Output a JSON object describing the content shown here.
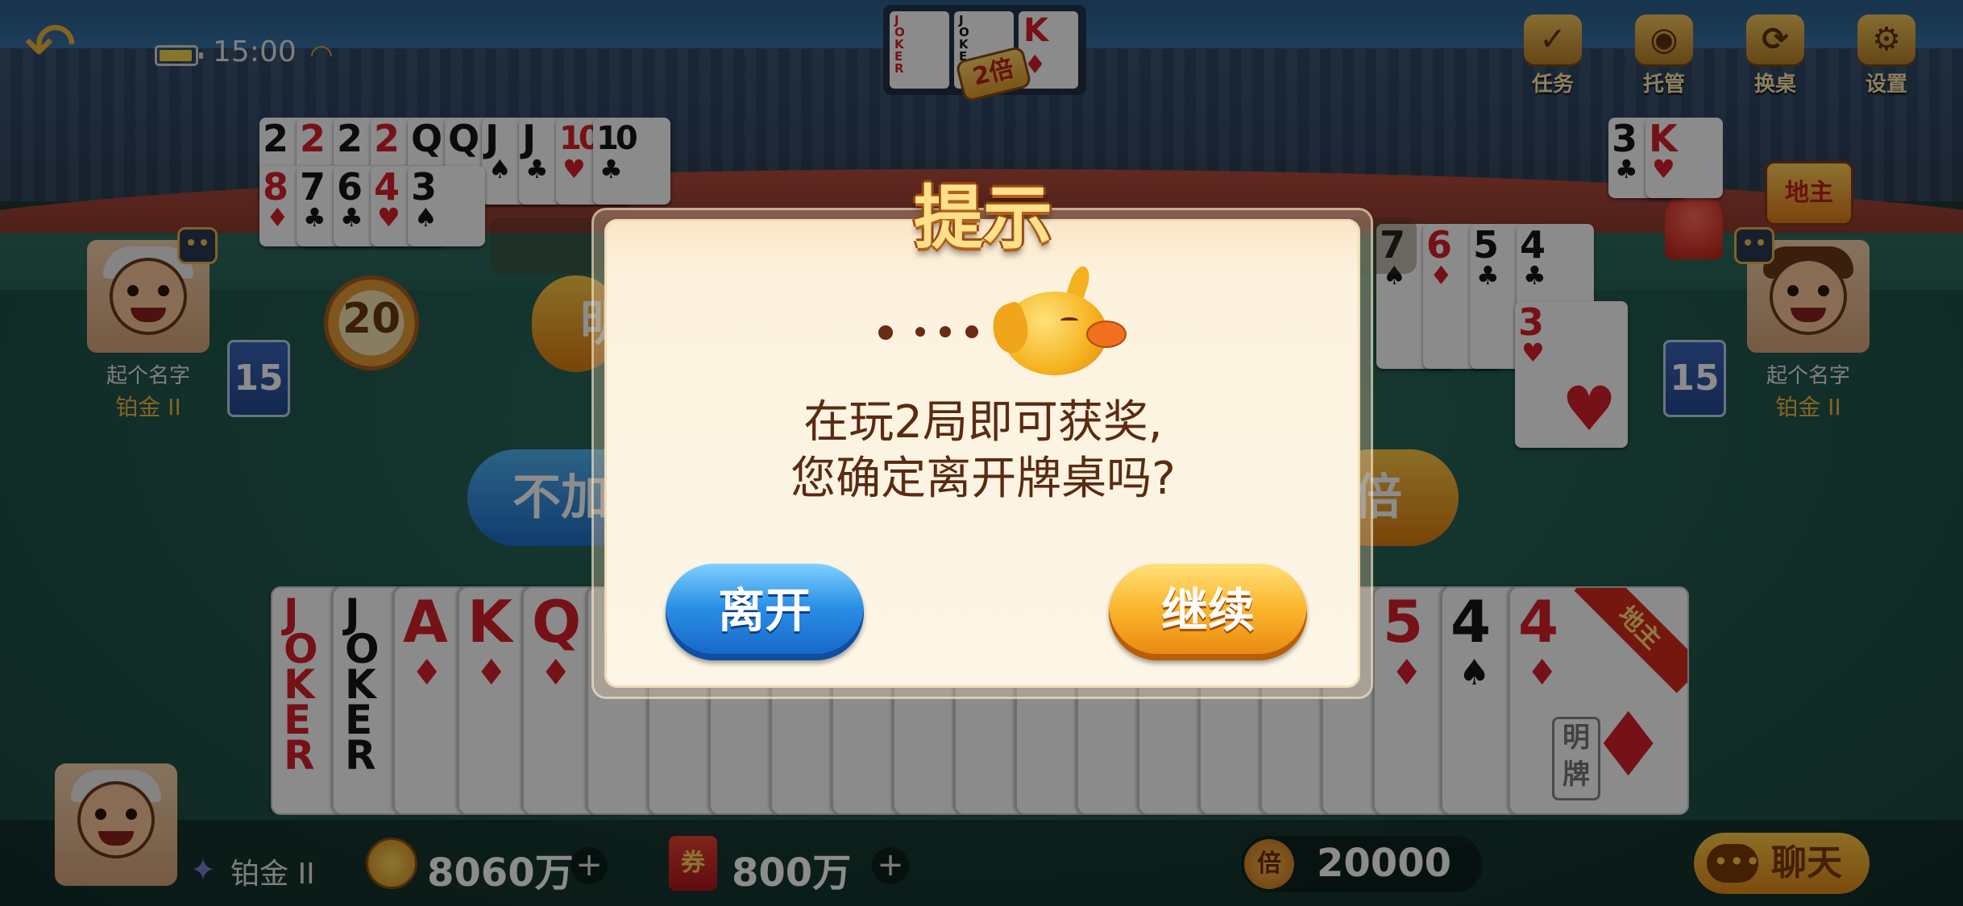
{
  "status": {
    "time": "15:00"
  },
  "toolbar": [
    {
      "label": "任务",
      "icon": "task-icon"
    },
    {
      "label": "托管",
      "icon": "robot-icon"
    },
    {
      "label": "换桌",
      "icon": "refresh-icon"
    },
    {
      "label": "设置",
      "icon": "gear-icon"
    }
  ],
  "base_cards": {
    "cards": [
      {
        "rank": "JOKER",
        "color": "red"
      },
      {
        "rank": "JOKER",
        "color": "black"
      },
      {
        "rank": "K",
        "suit": "♦",
        "color": "red"
      }
    ],
    "multiplier": "2倍"
  },
  "left_player": {
    "name": "起个名字",
    "rank": "铂金 II",
    "cards_left": "15",
    "timer": "20",
    "played_row1": [
      {
        "rank": "2",
        "suit": "",
        "color": "black"
      },
      {
        "rank": "2",
        "suit": "",
        "color": "red"
      },
      {
        "rank": "2",
        "suit": "",
        "color": "black"
      },
      {
        "rank": "2",
        "suit": "",
        "color": "red"
      },
      {
        "rank": "Q",
        "suit": "",
        "color": "black"
      },
      {
        "rank": "Q",
        "suit": "",
        "color": "black"
      },
      {
        "rank": "J",
        "suit": "♠",
        "color": "black"
      },
      {
        "rank": "J",
        "suit": "♣",
        "color": "black"
      },
      {
        "rank": "10",
        "suit": "♥",
        "color": "red"
      },
      {
        "rank": "10",
        "suit": "♣",
        "color": "black"
      }
    ],
    "played_row2": [
      {
        "rank": "8",
        "suit": "♦",
        "color": "red"
      },
      {
        "rank": "7",
        "suit": "♣",
        "color": "black"
      },
      {
        "rank": "6",
        "suit": "♣",
        "color": "black"
      },
      {
        "rank": "4",
        "suit": "♥",
        "color": "red"
      },
      {
        "rank": "3",
        "suit": "♠",
        "color": "black"
      }
    ]
  },
  "right_player": {
    "name": "起个名字",
    "rank": "铂金 II",
    "cards_left": "15",
    "landlord_badge": "地主",
    "top_cards": [
      {
        "rank": "3",
        "suit": "♣",
        "color": "black"
      },
      {
        "rank": "K",
        "suit": "♥",
        "color": "red"
      }
    ],
    "played": [
      {
        "rank": "7",
        "suit": "♠",
        "color": "black"
      },
      {
        "rank": "6",
        "suit": "♦",
        "color": "red"
      },
      {
        "rank": "5",
        "suit": "♣",
        "color": "black"
      },
      {
        "rank": "4",
        "suit": "♣",
        "color": "black"
      }
    ],
    "played_low": {
      "rank": "3",
      "suit": "♥",
      "color": "red"
    }
  },
  "actions": {
    "no_double_partial": "不加",
    "double_partial": "倍",
    "show_partial": "明"
  },
  "hand": {
    "cards": [
      {
        "rank": "JOKER",
        "suit": "",
        "color": "red"
      },
      {
        "rank": "JOKER",
        "suit": "",
        "color": "black"
      },
      {
        "rank": "A",
        "suit": "♦",
        "color": "red"
      },
      {
        "rank": "K",
        "suit": "♦",
        "color": "red"
      },
      {
        "rank": "Q",
        "suit": "♦",
        "color": "red"
      },
      {
        "rank": "5",
        "suit": "♦",
        "color": "red"
      },
      {
        "rank": "4",
        "suit": "♠",
        "color": "black"
      },
      {
        "rank": "4",
        "suit": "♦",
        "color": "red"
      }
    ],
    "ming_tag": "明牌",
    "landlord_ribbon": "地主"
  },
  "bottom": {
    "my_rank": "铂金 II",
    "coins": "8060万",
    "tickets": "800万",
    "ticket_icon": "券",
    "multiplier_icon": "倍",
    "multiplier": "20000",
    "chat_label": "聊天"
  },
  "dialog": {
    "title": "提示",
    "message_line1": "在玩2局即可获奖,",
    "message_line2": "您确定离开牌桌吗?",
    "leave_label": "离开",
    "continue_label": "继续"
  },
  "colors": {
    "red_card": "#d8202a",
    "black_card": "#151515",
    "leave_button": "#2a8fe6",
    "continue_button": "#fbb72e",
    "title_gold": "#ffe18a"
  }
}
